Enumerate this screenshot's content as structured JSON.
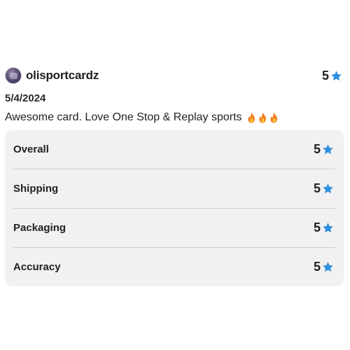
{
  "review": {
    "username": "olisportcardz",
    "rating": "5",
    "date": "5/4/2024",
    "comment": "Awesome card. Love One Stop & Replay sports",
    "emoji_icon": "fire-icon",
    "star_icon": "star-icon",
    "star_color": "#2f8fe0",
    "fire_color": "#f07a1a",
    "categories": [
      {
        "label": "Overall",
        "rating": "5"
      },
      {
        "label": "Shipping",
        "rating": "5"
      },
      {
        "label": "Packaging",
        "rating": "5"
      },
      {
        "label": "Accuracy",
        "rating": "5"
      }
    ]
  }
}
